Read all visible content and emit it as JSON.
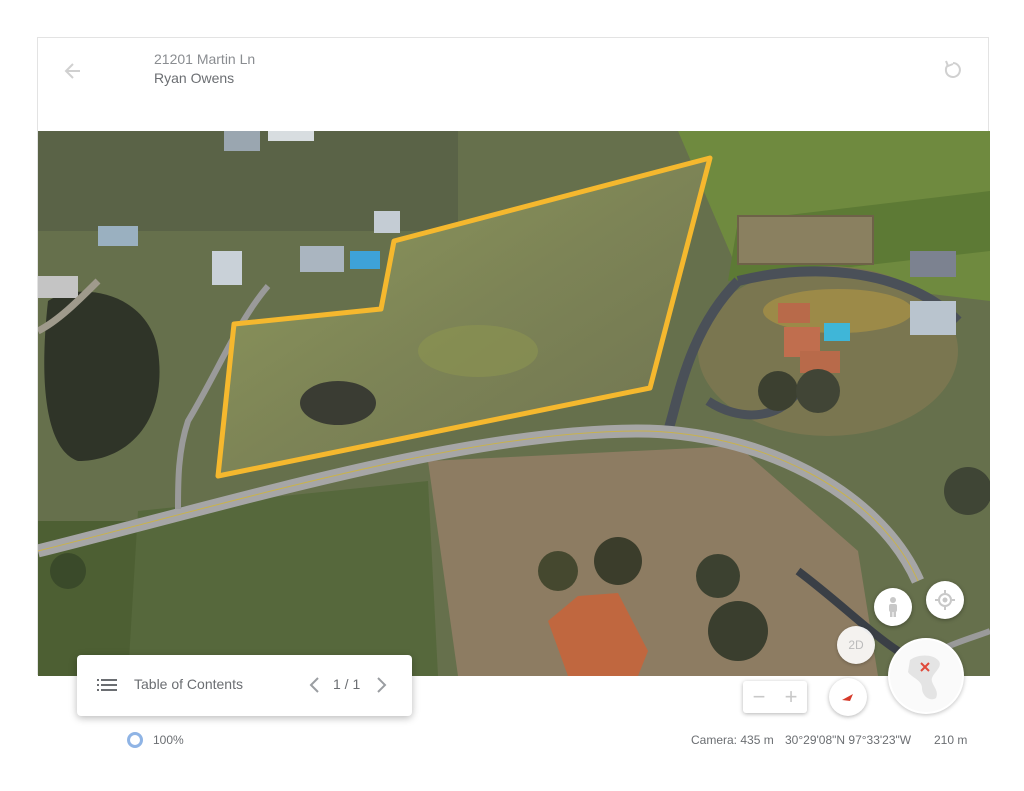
{
  "header": {
    "address": "21201 Martin Ln",
    "owner": "Ryan Owens"
  },
  "icons": {
    "back": "arrow-left-icon",
    "refresh": "refresh-icon",
    "toc": "list-icon",
    "street_view": "pegman-icon",
    "my_location": "my-location-icon",
    "compass": "compass-icon",
    "globe": "globe-icon"
  },
  "map": {
    "parcel_color": "#f5b82e",
    "view_mode_label": "2D"
  },
  "toc": {
    "label": "Table of Contents",
    "page": "1 / 1"
  },
  "zoom": {
    "minus": "−",
    "plus": "+"
  },
  "status": {
    "load_percent": "100%",
    "camera": "Camera: 435 m",
    "coordinates": "30°29'08\"N 97°33'23\"W",
    "scale": "210 m"
  }
}
